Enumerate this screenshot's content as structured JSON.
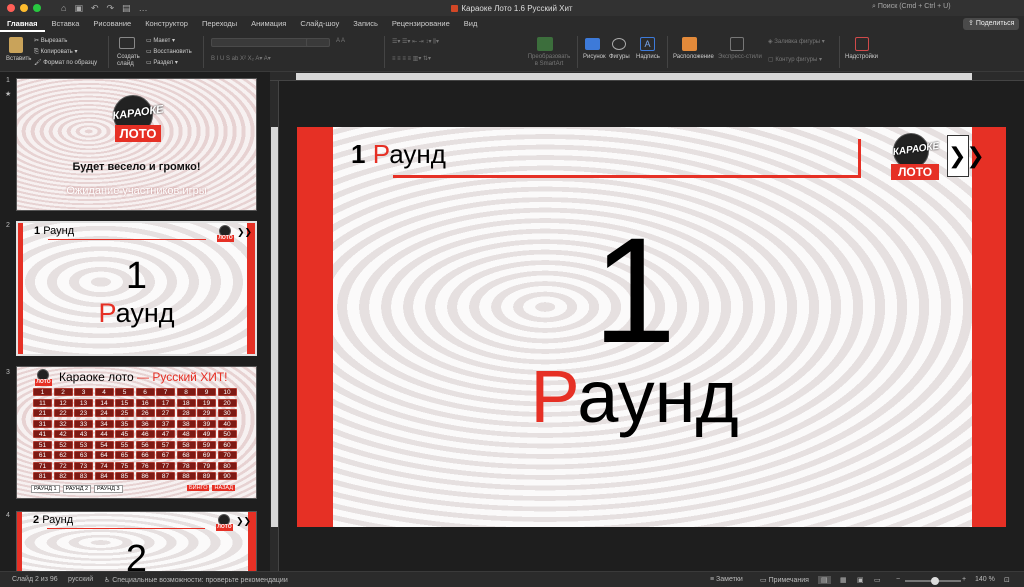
{
  "window": {
    "title": "Караоке Лото 1.6 Русский Хит",
    "search_placeholder": "Поиск (Cmd + Ctrl + U)",
    "share_label": "Поделиться"
  },
  "colors": {
    "accent": "#e63025",
    "app_bg": "#1e1e1e",
    "ribbon_bg": "#2b2b2b"
  },
  "tabs": [
    "Главная",
    "Вставка",
    "Рисование",
    "Конструктор",
    "Переходы",
    "Анимация",
    "Слайд-шоу",
    "Запись",
    "Рецензирование",
    "Вид"
  ],
  "ribbon": {
    "paste": "Вставить",
    "cut": "Вырезать",
    "copy": "Копировать",
    "format_painter": "Формат по образцу",
    "create_slide": "Создать слайд",
    "layout": "Макет",
    "reset": "Восстановить",
    "section": "Раздел",
    "smartart": "Преобразовать в SmartArt",
    "picture": "Рисунок",
    "shapes": "Фигуры",
    "textbox": "Надпись",
    "arrange": "Расположение",
    "quick_styles": "Экспресс-стили",
    "shape_fill": "Заливка фигуры",
    "shape_outline": "Контур фигуры",
    "addins": "Надстройки"
  },
  "thumbnails": {
    "slide1": {
      "num": "1",
      "star": "★",
      "logo_top": "КАРАОКЕ",
      "logo_bottom": "ЛОТО",
      "tagline": "Будет весело и громко!",
      "subtitle": "Ожидание участников игры"
    },
    "slide2": {
      "num": "2",
      "round_num": "1",
      "round_word": "Раунд",
      "big_num": "1",
      "big_word": "Раунд"
    },
    "slide3": {
      "num": "3",
      "title_a": "Караоке лото",
      "title_b": " — Русский ХИТ!",
      "numbers": [
        "1",
        "2",
        "3",
        "4",
        "5",
        "6",
        "7",
        "8",
        "9",
        "10",
        "11",
        "12",
        "13",
        "14",
        "15",
        "16",
        "17",
        "18",
        "19",
        "20",
        "21",
        "22",
        "23",
        "24",
        "25",
        "26",
        "27",
        "28",
        "29",
        "30",
        "31",
        "32",
        "33",
        "34",
        "35",
        "36",
        "37",
        "38",
        "39",
        "40",
        "41",
        "42",
        "43",
        "44",
        "45",
        "46",
        "47",
        "48",
        "49",
        "50",
        "51",
        "52",
        "53",
        "54",
        "55",
        "56",
        "57",
        "58",
        "59",
        "60",
        "61",
        "62",
        "63",
        "64",
        "65",
        "66",
        "67",
        "68",
        "69",
        "70",
        "71",
        "72",
        "73",
        "74",
        "75",
        "76",
        "77",
        "78",
        "79",
        "80",
        "81",
        "82",
        "83",
        "84",
        "85",
        "86",
        "87",
        "88",
        "89",
        "90"
      ],
      "buttons": [
        "РАУНД 1",
        "РАУНД 2",
        "РАУНД 3"
      ],
      "bingo": "БИНГО",
      "back": "НАЗАД"
    },
    "slide4": {
      "num": "4",
      "round_num": "2",
      "round_word": "Раунд",
      "big_num": "2"
    }
  },
  "main_slide": {
    "round_num": "1",
    "round_word": "Раунд",
    "big_num": "1",
    "big_word_first": "Р",
    "big_word_rest": "аунд",
    "logo_top": "КАРАОКЕ",
    "logo_bottom": "ЛОТО",
    "next_glyph": "❯❯"
  },
  "status": {
    "slide_info": "Слайд 2 из 96",
    "language": "русский",
    "accessibility": "Специальные возможности: проверьте рекомендации",
    "notes": "Заметки",
    "comments": "Примечания",
    "zoom": "140 %"
  }
}
